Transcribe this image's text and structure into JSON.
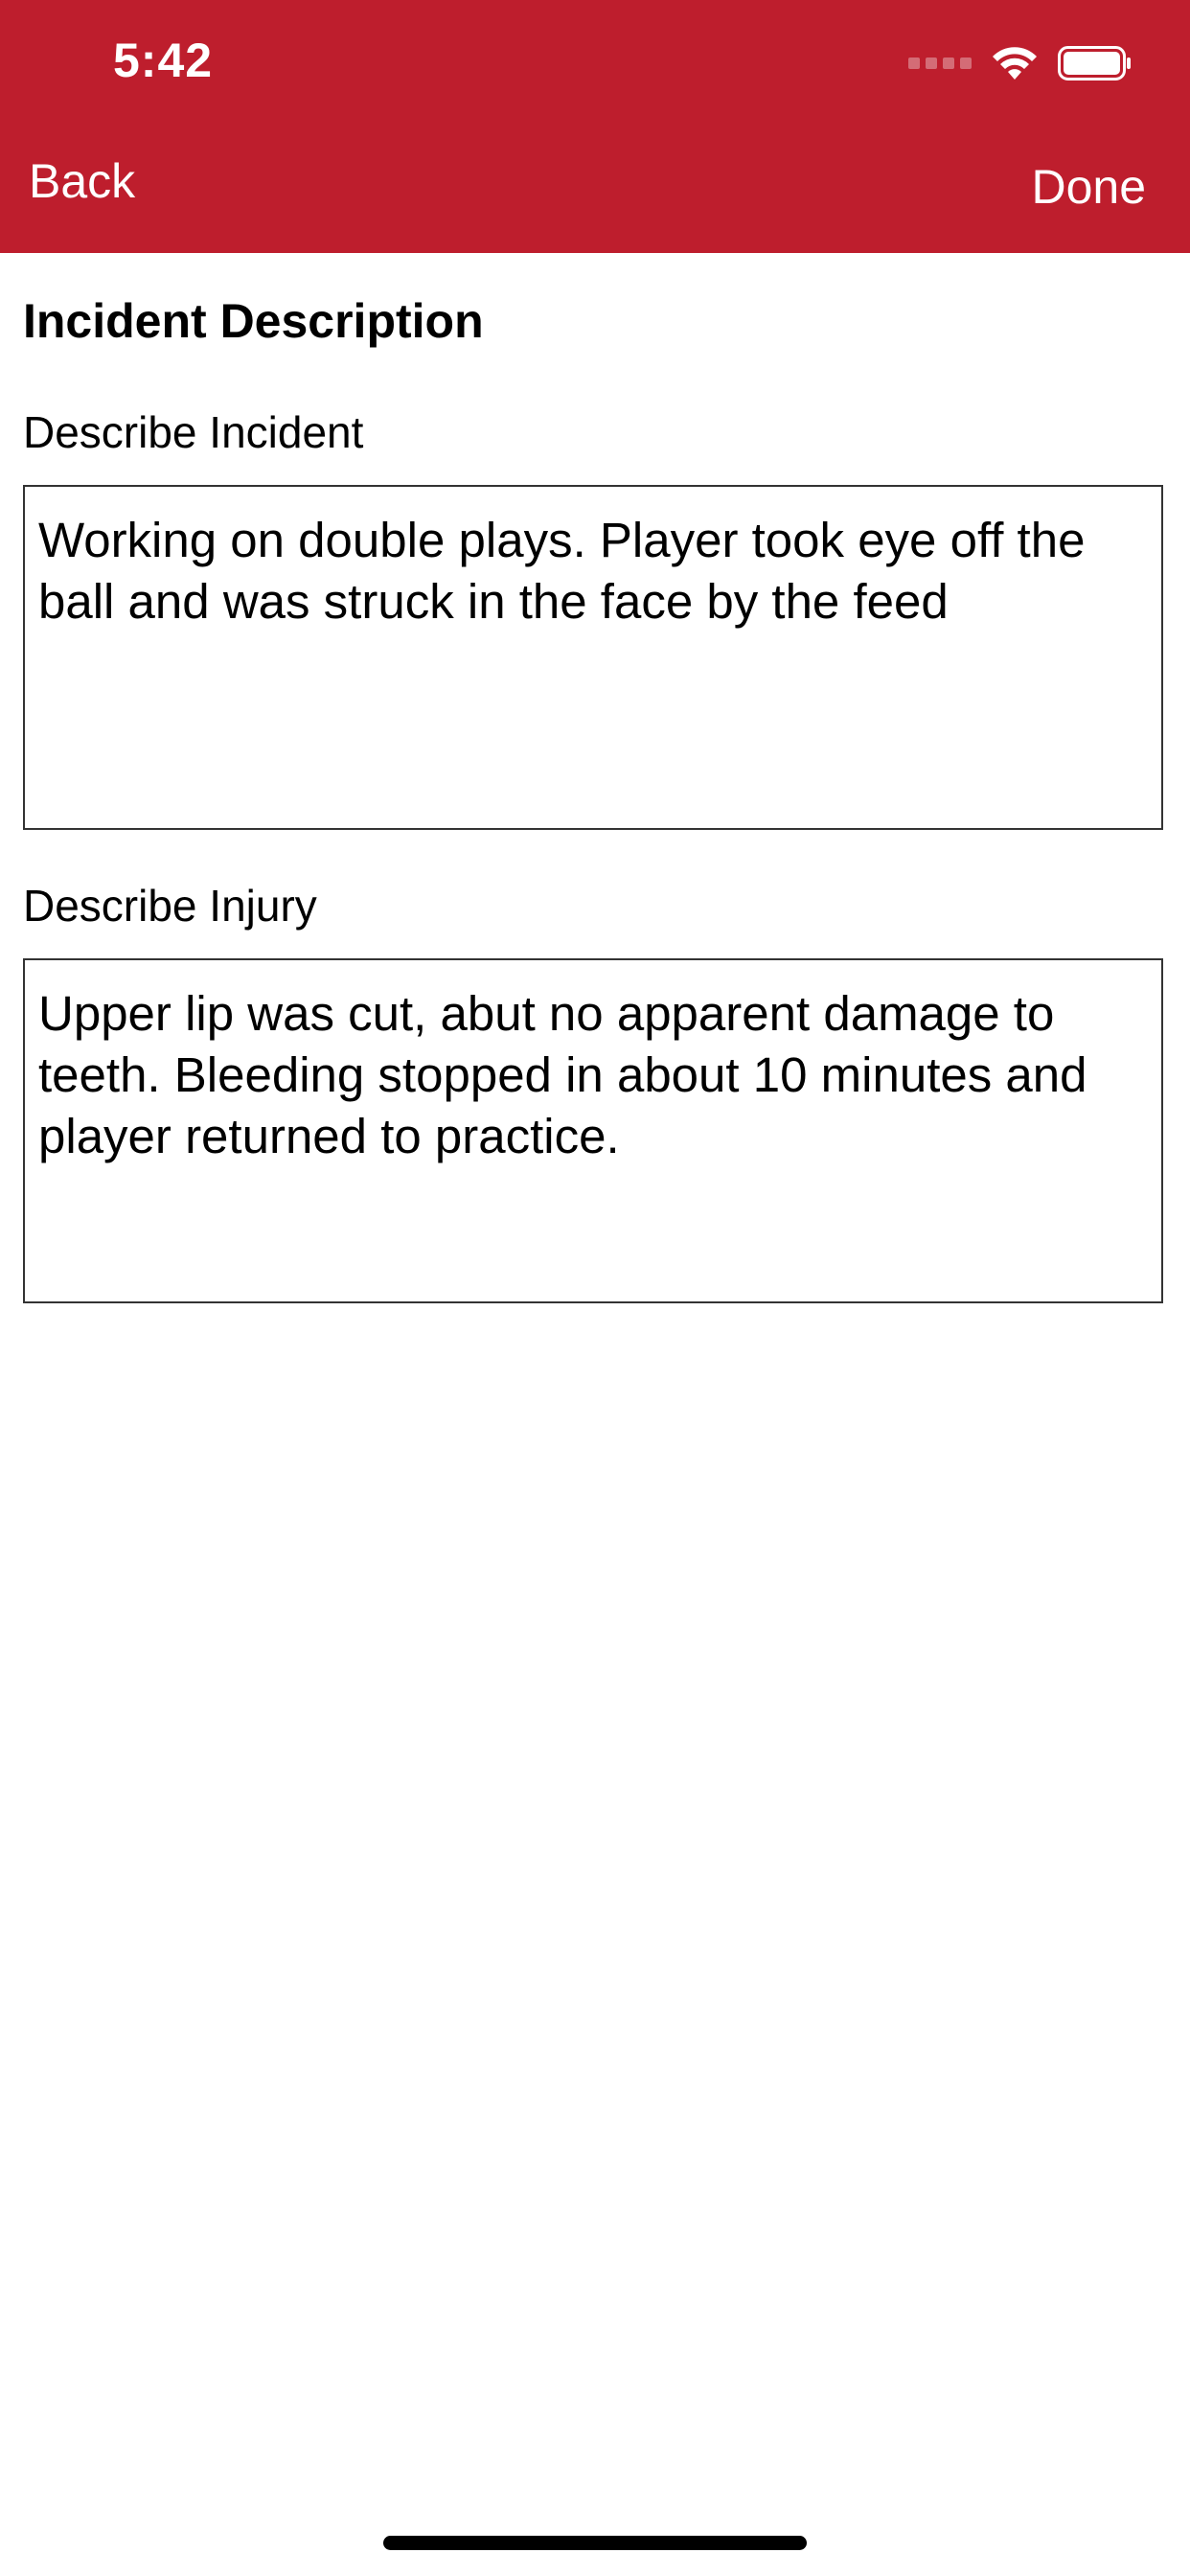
{
  "status_bar": {
    "time": "5:42"
  },
  "nav": {
    "back_label": "Back",
    "done_label": "Done"
  },
  "form": {
    "section_title": "Incident Description",
    "incident": {
      "label": "Describe Incident",
      "value": "Working on double plays. Player took eye off the ball and was struck in the face by the feed"
    },
    "injury": {
      "label": "Describe Injury",
      "value": "Upper lip was cut, abut no apparent damage to teeth. Bleeding stopped in about 10 minutes and player returned to practice."
    }
  },
  "icons": {
    "signal": "cellular-signal-icon",
    "wifi": "wifi-icon",
    "battery": "battery-icon"
  },
  "colors": {
    "header_background": "#be1e2d",
    "header_text": "#ffffff"
  }
}
